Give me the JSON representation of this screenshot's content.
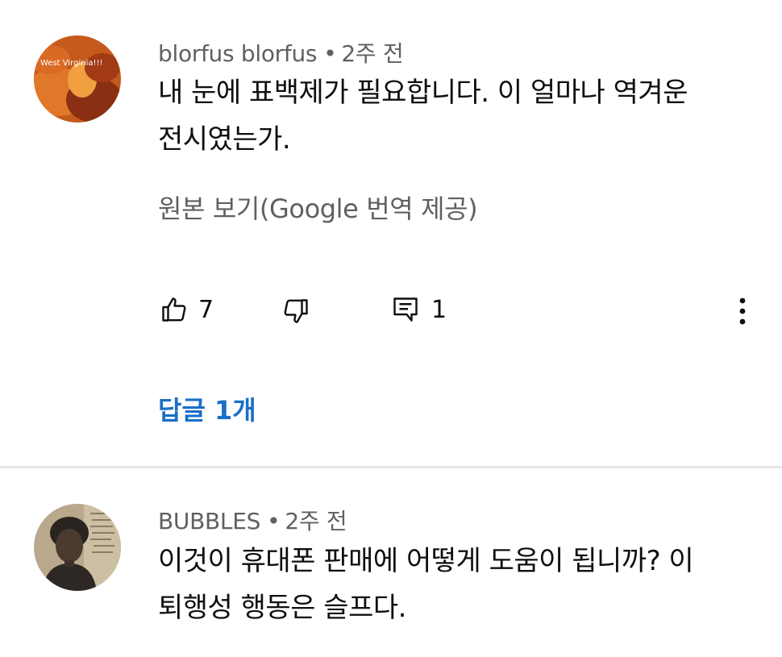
{
  "comments": [
    {
      "author": "blorfus blorfus",
      "separator": "•",
      "time": "2주 전",
      "avatar_text": "West Virginia!!!",
      "text_line1": "내 눈에 표백제가 필요합니다. 이 얼마나 역겨운",
      "text_line2": "전시였는가.",
      "see_original": "원본 보기(Google 번역 제공)",
      "like_count": "7",
      "reply_count": "1",
      "replies_label": "답글 1개"
    },
    {
      "author": "BUBBLES",
      "separator": "•",
      "time": "2주 전",
      "text_line1": "이것이 휴대폰 판매에 어떻게 도움이 됩니까? 이",
      "text_line2": "퇴행성 행동은 슬프다."
    }
  ],
  "icons": {
    "like": "thumbs-up-icon",
    "dislike": "thumbs-down-icon",
    "reply": "comment-icon",
    "more": "more-vertical-icon"
  },
  "colors": {
    "link": "#1a6fc7",
    "meta": "#606060",
    "text": "#0f0f0f",
    "divider": "#e6e6e6"
  }
}
